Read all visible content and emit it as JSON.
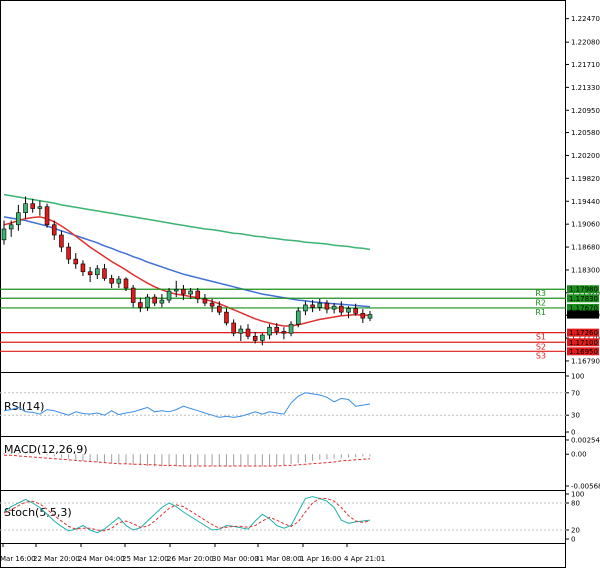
{
  "chart_data": {
    "type": "candlestick",
    "price_axis": {
      "ticks": [
        "1.22470",
        "1.22080",
        "1.21710",
        "1.21330",
        "1.20950",
        "1.20580",
        "1.20200",
        "1.19820",
        "1.19440",
        "1.19060",
        "1.18680",
        "1.18300",
        "1.17920",
        "1.17550",
        "1.17170",
        "1.16790"
      ],
      "ylim": [
        1.1664,
        1.2268
      ]
    },
    "time_axis": {
      "labels": [
        "Mar 16:00",
        "22 Mar 20:00",
        "24 Mar 04:00",
        "25 Mar 12:00",
        "26 Mar 20:00",
        "30 Mar 00:00",
        "31 Mar 08:00",
        "1 Apr 16:00",
        "4 Apr 21:01"
      ]
    },
    "candles_ohlc": [
      [
        1.188,
        1.1912,
        1.1872,
        1.1898
      ],
      [
        1.1898,
        1.1912,
        1.1885,
        1.1905
      ],
      [
        1.1905,
        1.1938,
        1.1895,
        1.1925
      ],
      [
        1.1925,
        1.1952,
        1.1915,
        1.194
      ],
      [
        1.194,
        1.1948,
        1.1925,
        1.1932
      ],
      [
        1.1932,
        1.1945,
        1.192,
        1.1935
      ],
      [
        1.1935,
        1.194,
        1.19,
        1.1905
      ],
      [
        1.1905,
        1.1912,
        1.188,
        1.1888
      ],
      [
        1.1888,
        1.1895,
        1.186,
        1.1868
      ],
      [
        1.1868,
        1.1875,
        1.184,
        1.1848
      ],
      [
        1.1848,
        1.1858,
        1.1832,
        1.184
      ],
      [
        1.184,
        1.1846,
        1.182,
        1.1827
      ],
      [
        1.1827,
        1.1835,
        1.181,
        1.1822
      ],
      [
        1.1822,
        1.1838,
        1.1815,
        1.1832
      ],
      [
        1.1832,
        1.184,
        1.1812,
        1.1816
      ],
      [
        1.1816,
        1.1822,
        1.18,
        1.1808
      ],
      [
        1.1808,
        1.182,
        1.18,
        1.1815
      ],
      [
        1.1815,
        1.1818,
        1.1795,
        1.18
      ],
      [
        1.18,
        1.1805,
        1.1768,
        1.1776
      ],
      [
        1.1776,
        1.1784,
        1.176,
        1.1768
      ],
      [
        1.1768,
        1.179,
        1.1762,
        1.1785
      ],
      [
        1.1785,
        1.179,
        1.177,
        1.1775
      ],
      [
        1.1775,
        1.179,
        1.1768,
        1.178
      ],
      [
        1.178,
        1.18,
        1.1775,
        1.1795
      ],
      [
        1.1795,
        1.1812,
        1.1785,
        1.1798
      ],
      [
        1.1798,
        1.1805,
        1.178,
        1.179
      ],
      [
        1.179,
        1.18,
        1.1782,
        1.1795
      ],
      [
        1.1795,
        1.18,
        1.1775,
        1.1782
      ],
      [
        1.1782,
        1.179,
        1.177,
        1.1775
      ],
      [
        1.1775,
        1.1782,
        1.176,
        1.177
      ],
      [
        1.177,
        1.1778,
        1.1755,
        1.176
      ],
      [
        1.176,
        1.1766,
        1.1738,
        1.1742
      ],
      [
        1.1742,
        1.1748,
        1.172,
        1.1725
      ],
      [
        1.1725,
        1.1738,
        1.1712,
        1.1732
      ],
      [
        1.1732,
        1.174,
        1.1715,
        1.172
      ],
      [
        1.172,
        1.1727,
        1.1708,
        1.1713
      ],
      [
        1.1713,
        1.1725,
        1.1705,
        1.1722
      ],
      [
        1.1722,
        1.174,
        1.1715,
        1.1735
      ],
      [
        1.1735,
        1.1742,
        1.1722,
        1.1728
      ],
      [
        1.1728,
        1.1735,
        1.1715,
        1.1725
      ],
      [
        1.1725,
        1.1745,
        1.172,
        1.174
      ],
      [
        1.174,
        1.1768,
        1.1735,
        1.1762
      ],
      [
        1.1762,
        1.1778,
        1.1755,
        1.1772
      ],
      [
        1.1772,
        1.178,
        1.176,
        1.1768
      ],
      [
        1.1768,
        1.1782,
        1.1762,
        1.1775
      ],
      [
        1.1775,
        1.178,
        1.1758,
        1.1765
      ],
      [
        1.1765,
        1.1775,
        1.1758,
        1.177
      ],
      [
        1.177,
        1.1778,
        1.1755,
        1.176
      ],
      [
        1.176,
        1.177,
        1.175,
        1.1766
      ],
      [
        1.1766,
        1.1774,
        1.1754,
        1.1758
      ],
      [
        1.1758,
        1.1765,
        1.1742,
        1.175
      ],
      [
        1.175,
        1.1762,
        1.1745,
        1.1756
      ]
    ],
    "moving_averages": [
      {
        "color": "#3f6fd8",
        "values": [
          1.1918,
          1.1916,
          1.1914,
          1.1912,
          1.1909,
          1.1906,
          1.1903,
          1.1899,
          1.1895,
          1.1891,
          1.1887,
          1.1883,
          1.1879,
          1.1875,
          1.187,
          1.1866,
          1.1861,
          1.1857,
          1.1852,
          1.1848,
          1.1843,
          1.1839,
          1.1835,
          1.1831,
          1.1827,
          1.1823,
          1.182,
          1.1817,
          1.1814,
          1.1811,
          1.1808,
          1.1805,
          1.1802,
          1.1799,
          1.1796,
          1.1793,
          1.179,
          1.1788,
          1.1786,
          1.1784,
          1.1782,
          1.178,
          1.1779,
          1.1777,
          1.1776,
          1.1775,
          1.1774,
          1.1773,
          1.1772,
          1.1771,
          1.177,
          1.1769
        ]
      },
      {
        "color": "#e03030",
        "values": [
          1.1905,
          1.1908,
          1.1912,
          1.1915,
          1.1917,
          1.1918,
          1.1915,
          1.191,
          1.1903,
          1.1895,
          1.1886,
          1.1877,
          1.1868,
          1.186,
          1.1852,
          1.1844,
          1.1837,
          1.183,
          1.1822,
          1.1815,
          1.1808,
          1.1802,
          1.1797,
          1.1793,
          1.179,
          1.1788,
          1.1786,
          1.1784,
          1.1781,
          1.1778,
          1.1774,
          1.1769,
          1.1764,
          1.1759,
          1.1754,
          1.1749,
          1.1745,
          1.1742,
          1.1739,
          1.1737,
          1.1737,
          1.1739,
          1.1742,
          1.1745,
          1.1748,
          1.175,
          1.1752,
          1.1754,
          1.1755,
          1.1756,
          1.1755,
          1.1755
        ]
      },
      {
        "color": "#3cb371",
        "values": [
          1.1955,
          1.1953,
          1.1951,
          1.1949,
          1.1947,
          1.1945,
          1.1943,
          1.1941,
          1.1938,
          1.1936,
          1.1934,
          1.1932,
          1.193,
          1.1928,
          1.1926,
          1.1924,
          1.1922,
          1.192,
          1.1918,
          1.1916,
          1.1914,
          1.1912,
          1.191,
          1.1908,
          1.1906,
          1.1904,
          1.1902,
          1.19,
          1.1898,
          1.1897,
          1.1895,
          1.1893,
          1.1891,
          1.189,
          1.1888,
          1.1886,
          1.1885,
          1.1883,
          1.1882,
          1.188,
          1.1879,
          1.1878,
          1.1876,
          1.1875,
          1.1874,
          1.1873,
          1.1871,
          1.187,
          1.1869,
          1.1867,
          1.1866,
          1.1864
        ]
      }
    ],
    "levels": [
      {
        "name": "R3",
        "value": 1.1798,
        "label": "1.17980",
        "color": "#1a8f1a"
      },
      {
        "name": "R2",
        "value": 1.1783,
        "label": "1.17830",
        "color": "#1a8f1a"
      },
      {
        "name": "R1",
        "value": 1.1767,
        "label": "1.17670",
        "color": "#1a8f1a"
      },
      {
        "name": "S1",
        "value": 1.1726,
        "label": "1.17260",
        "color": "#e01b1b"
      },
      {
        "name": "S2",
        "value": 1.171,
        "label": "1.17100",
        "color": "#e01b1b"
      },
      {
        "name": "S3",
        "value": 1.1695,
        "label": "1.16950",
        "color": "#e01b1b"
      }
    ],
    "current_price": {
      "value": 1.1756,
      "label": "1.17560"
    },
    "rsi": {
      "title": "RSI(14)",
      "ticks": [
        "100",
        "70",
        "30",
        "0"
      ],
      "values": [
        38,
        40,
        44,
        36,
        35,
        32,
        40,
        38,
        34,
        30,
        36,
        33,
        32,
        34,
        30,
        38,
        31,
        34,
        36,
        40,
        44,
        36,
        38,
        36,
        40,
        46,
        42,
        38,
        34,
        30,
        26,
        28,
        26,
        28,
        32,
        36,
        32,
        36,
        34,
        32,
        52,
        64,
        70,
        68,
        66,
        62,
        54,
        60,
        58,
        46,
        48,
        50
      ]
    },
    "macd": {
      "title": "MACD(12,26,9)",
      "ticks": [
        "0.002545",
        "0.00",
        "-0.005688"
      ],
      "histogram": [
        0.0002,
        0.0002,
        0.0002,
        0.0001,
        0.0001,
        0.0,
        -0.0002,
        -0.0004,
        -0.0006,
        -0.0008,
        -0.001,
        -0.0012,
        -0.0013,
        -0.0014,
        -0.0015,
        -0.0016,
        -0.0017,
        -0.0018,
        -0.0019,
        -0.002,
        -0.0021,
        -0.0022,
        -0.0022,
        -0.0022,
        -0.0022,
        -0.0022,
        -0.0021,
        -0.0021,
        -0.0021,
        -0.0021,
        -0.0021,
        -0.0021,
        -0.0021,
        -0.0022,
        -0.0022,
        -0.0022,
        -0.0022,
        -0.0021,
        -0.0021,
        -0.002,
        -0.0018,
        -0.0016,
        -0.0014,
        -0.0012,
        -0.001,
        -0.0009,
        -0.0008,
        -0.0007,
        -0.0006,
        -0.0005,
        -0.0004,
        -0.0004
      ],
      "signal": [
        -0.0002,
        -0.0002,
        -0.0003,
        -0.0004,
        -0.0005,
        -0.0006,
        -0.0007,
        -0.0008,
        -0.0009,
        -0.001,
        -0.0011,
        -0.0012,
        -0.0013,
        -0.0014,
        -0.0015,
        -0.0016,
        -0.0017,
        -0.0017,
        -0.0018,
        -0.0018,
        -0.0019,
        -0.0019,
        -0.002,
        -0.002,
        -0.002,
        -0.0021,
        -0.0021,
        -0.0021,
        -0.0021,
        -0.0021,
        -0.0021,
        -0.0021,
        -0.0021,
        -0.0021,
        -0.0021,
        -0.0021,
        -0.0021,
        -0.0021,
        -0.0021,
        -0.002,
        -0.002,
        -0.0019,
        -0.0018,
        -0.0017,
        -0.0016,
        -0.0015,
        -0.0014,
        -0.0012,
        -0.0011,
        -0.001,
        -0.0009,
        -0.0008
      ]
    },
    "stoch": {
      "title": "Stoch(5,5,3)",
      "ticks": [
        "100",
        "80",
        "20",
        "0"
      ],
      "k": [
        60,
        72,
        80,
        88,
        80,
        70,
        55,
        40,
        28,
        18,
        22,
        30,
        20,
        14,
        22,
        35,
        48,
        30,
        20,
        25,
        40,
        55,
        70,
        80,
        72,
        60,
        50,
        40,
        30,
        20,
        22,
        30,
        28,
        25,
        22,
        40,
        55,
        45,
        30,
        24,
        30,
        60,
        90,
        94,
        90,
        84,
        70,
        42,
        35,
        38,
        40,
        42
      ],
      "d": [
        58,
        65,
        74,
        82,
        84,
        78,
        66,
        52,
        40,
        28,
        22,
        24,
        24,
        20,
        18,
        24,
        36,
        40,
        34,
        26,
        28,
        40,
        54,
        68,
        76,
        72,
        62,
        52,
        42,
        32,
        24,
        26,
        28,
        28,
        26,
        30,
        40,
        48,
        42,
        34,
        28,
        38,
        60,
        80,
        90,
        90,
        84,
        70,
        52,
        40,
        37,
        40
      ]
    }
  }
}
